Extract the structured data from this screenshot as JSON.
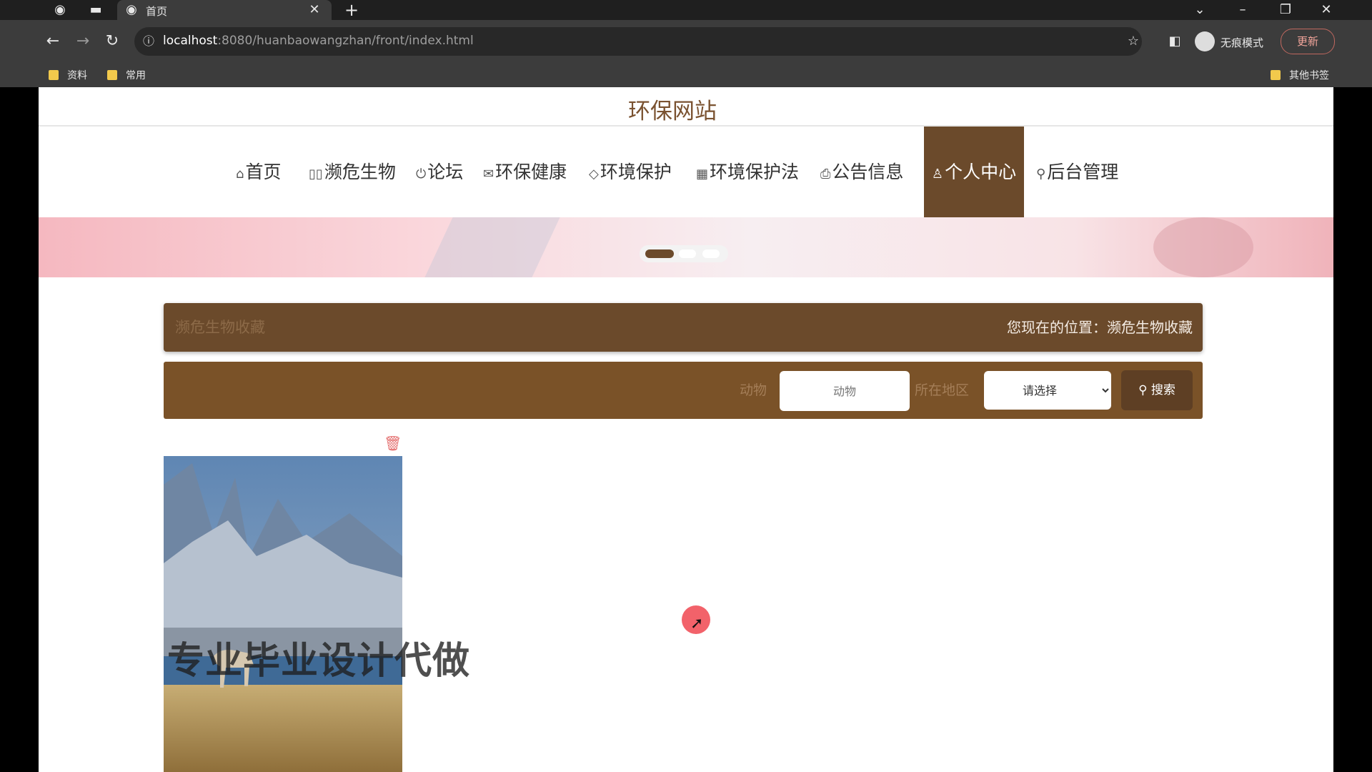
{
  "browser": {
    "tab_title": "首页",
    "url_host": "localhost",
    "url_rest": ":8080/huanbaowangzhan/front/index.html",
    "profile_label": "无痕模式",
    "update_label": "更新",
    "bookmarks": [
      "资料",
      "常用"
    ],
    "other_bookmarks": "其他书签"
  },
  "site": {
    "title": "环保网站"
  },
  "nav": {
    "items": [
      {
        "icon": "⌂",
        "label": "首页"
      },
      {
        "icon": "▯▯",
        "label": "濒危生物"
      },
      {
        "icon": "⏻",
        "label": "论坛"
      },
      {
        "icon": "✉",
        "label": "环保健康"
      },
      {
        "icon": "◇",
        "label": "环境保护"
      },
      {
        "icon": "▦",
        "label": "环境保护法"
      },
      {
        "icon": "⎙",
        "label": "公告信息"
      },
      {
        "icon": "♙",
        "label": "个人中心"
      },
      {
        "icon": "⚲",
        "label": "后台管理"
      }
    ],
    "active": "个人中心"
  },
  "breadcrumb": {
    "title": "濒危生物收藏",
    "position": "您现在的位置：濒危生物收藏"
  },
  "search": {
    "animal_label": "动物",
    "animal_placeholder": "动物",
    "region_label": "所在地区",
    "region_selected": "请选择",
    "button_label": "搜索"
  },
  "overlay": {
    "watermark": "专业毕业设计代做"
  },
  "colors": {
    "brand_brown": "#6b4a2b",
    "search_bar": "#7a5228",
    "title_color": "#7a5230"
  }
}
